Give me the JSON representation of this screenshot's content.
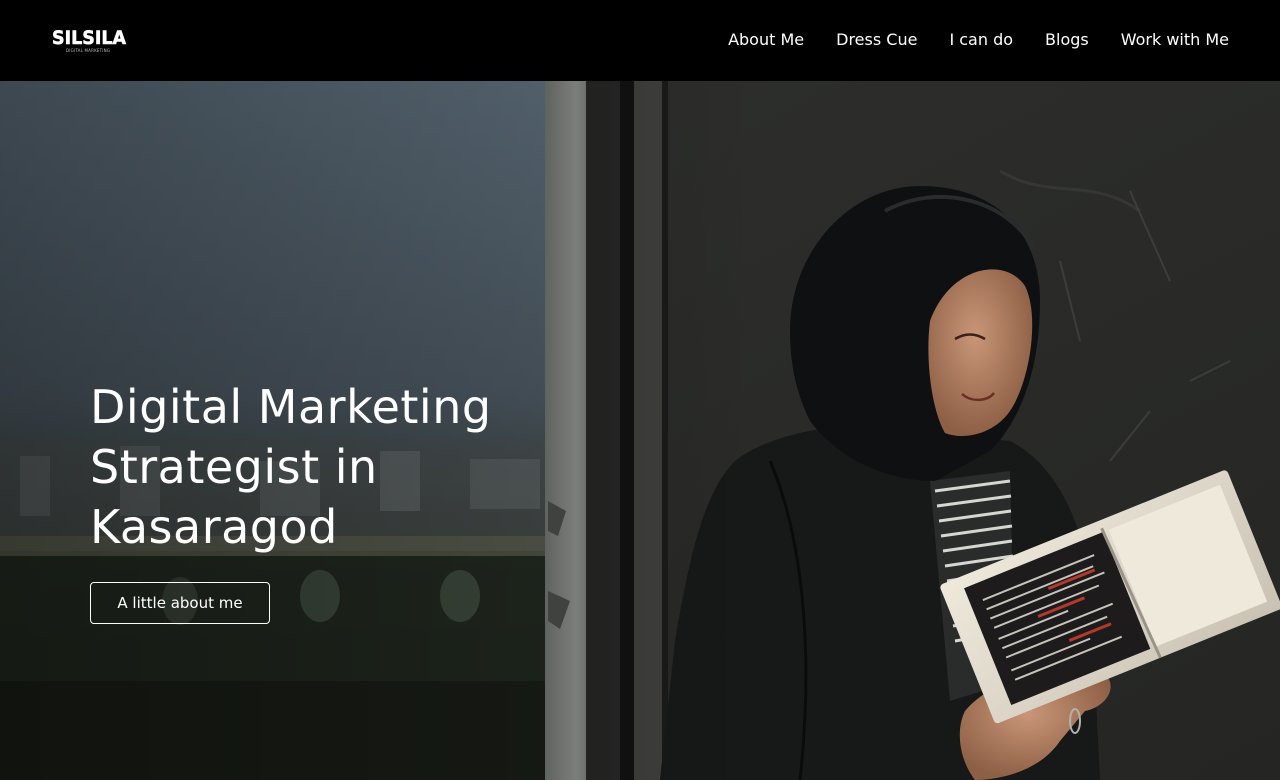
{
  "brand": {
    "logo_text": "SILSILA",
    "logo_tagline": "DIGITAL MARKETING"
  },
  "nav": {
    "items": [
      {
        "label": "About Me"
      },
      {
        "label": "Dress Cue"
      },
      {
        "label": "I can do"
      },
      {
        "label": "Blogs"
      },
      {
        "label": "Work with Me"
      }
    ]
  },
  "hero": {
    "title_line1": "Digital Marketing",
    "title_line2": "Strategist in",
    "title_line3": "Kasaragod",
    "cta_label": "A little about me"
  },
  "colors": {
    "header_bg": "#000000",
    "text": "#ffffff",
    "wall": "#2b2c2a",
    "window_sky": "#5d6e7a"
  }
}
